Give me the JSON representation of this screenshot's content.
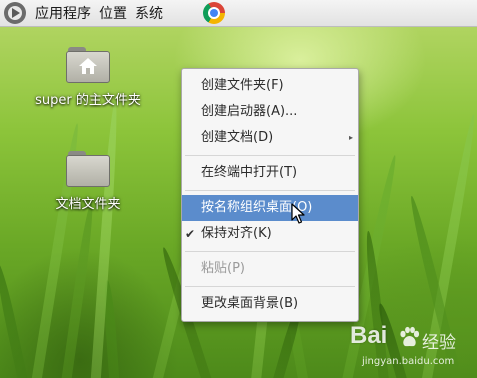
{
  "top_panel": {
    "logo_icon": "app-menu-logo-icon",
    "menus": [
      "应用程序",
      "位置",
      "系统"
    ],
    "launcher_icon": "chrome-icon"
  },
  "desktop": {
    "icons": [
      {
        "label": "super 的主文件夹",
        "icon": "home-folder-icon"
      },
      {
        "label": "文档文件夹",
        "icon": "folder-icon"
      }
    ]
  },
  "context_menu": {
    "items": [
      {
        "label": "创建文件夹(F)"
      },
      {
        "label": "创建启动器(A)..."
      },
      {
        "label": "创建文档(D)",
        "submenu": true
      },
      {
        "label": "在终端中打开(T)"
      },
      {
        "label": "按名称组织桌面(O)",
        "highlighted": true
      },
      {
        "label": "保持对齐(K)",
        "checked": true
      },
      {
        "label": "粘贴(P)",
        "disabled": true
      },
      {
        "label": "更改桌面背景(B)"
      }
    ],
    "check_mark": "✔",
    "submenu_arrow": "▸",
    "highlight_color": "#5b8ccc"
  },
  "watermark": {
    "brand": "Bai",
    "brand_suffix": "经验",
    "url": "jingyan.baidu.com"
  }
}
